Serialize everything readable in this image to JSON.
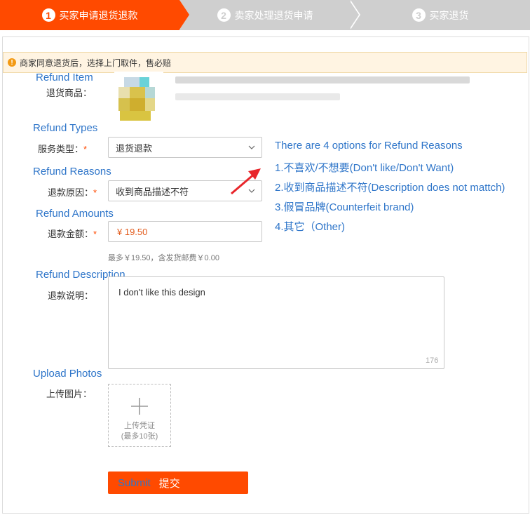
{
  "steps": [
    {
      "num": "1",
      "label": "买家申请退货退款"
    },
    {
      "num": "2",
      "label": "卖家处理退货申请"
    },
    {
      "num": "3",
      "label": "买家退货"
    }
  ],
  "notice": {
    "icon": "warning-icon",
    "text": "商家同意退货后，选择上门取件，售必赔"
  },
  "refund_item": {
    "annotation": "Refund Item",
    "label": "退货商品："
  },
  "refund_types": {
    "annotation": "Refund Types",
    "label": "服务类型：",
    "required": "*",
    "value": "退货退款"
  },
  "refund_reasons": {
    "annotation": "Refund Reasons",
    "label": "退款原因：",
    "required": "*",
    "value": "收到商品描述不符"
  },
  "refund_amounts": {
    "annotation": "Refund Amounts",
    "label": "退款金额：",
    "required": "*",
    "value": "¥ 19.50",
    "hint": "最多￥19.50，含发货邮费￥0.00"
  },
  "refund_description": {
    "annotation": "Refund Description",
    "label": "退款说明：",
    "value": "I don't like this design",
    "counter": "176"
  },
  "upload": {
    "annotation": "Upload Photos",
    "label": "上传图片：",
    "icon": "plus-icon",
    "button_line1": "上传凭证",
    "button_line2": "(最多10张)"
  },
  "submit": {
    "en": "Submit",
    "zh": "提交"
  },
  "reasons_annotation": {
    "title": "There are 4 options for Refund Reasons",
    "options": [
      "1.不喜欢/不想要(Don't like/Don't Want)",
      "2.收到商品描述不符(Description does not mattch)",
      "3.假冒品牌(Counterfeit brand)",
      "4.其它（Other)"
    ]
  },
  "colors": {
    "accent": "#ff4a00",
    "annotation": "#2e75c9",
    "inactive_step": "#cfcfcf"
  }
}
